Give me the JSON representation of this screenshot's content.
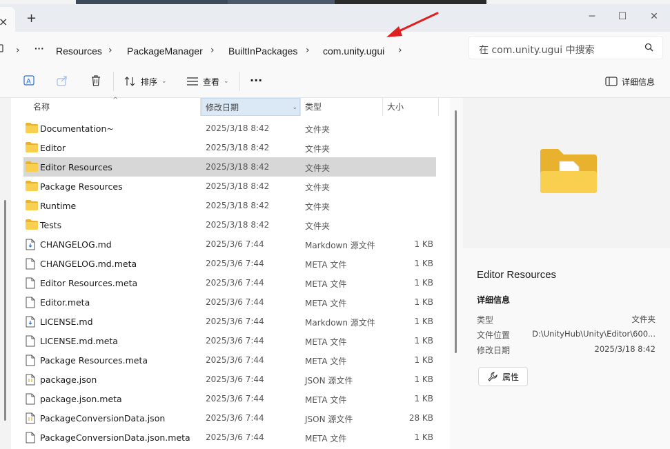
{
  "window": {
    "tab_close_icon": "×",
    "new_tab_icon": "+",
    "minimize": "─",
    "maximize": "☐",
    "close": "✕"
  },
  "breadcrumb": {
    "more": "···",
    "items": [
      "Resources",
      "PackageManager",
      "BuiltInPackages",
      "com.unity.ugui"
    ]
  },
  "search": {
    "placeholder": "在 com.unity.ugui 中搜索"
  },
  "toolbar": {
    "sort_label": "排序",
    "view_label": "查看",
    "more_label": "···",
    "details_label": "详细信息"
  },
  "columns": {
    "name": "名称",
    "date": "修改日期",
    "type": "类型",
    "size": "大小"
  },
  "files": [
    {
      "name": "Documentation~",
      "date": "2025/3/18 8:42",
      "type": "文件夹",
      "size": "",
      "icon": "folder-icon"
    },
    {
      "name": "Editor",
      "date": "2025/3/18 8:42",
      "type": "文件夹",
      "size": "",
      "icon": "folder-icon"
    },
    {
      "name": "Editor Resources",
      "date": "2025/3/18 8:42",
      "type": "文件夹",
      "size": "",
      "icon": "folder-icon",
      "selected": true
    },
    {
      "name": "Package Resources",
      "date": "2025/3/18 8:42",
      "type": "文件夹",
      "size": "",
      "icon": "folder-icon"
    },
    {
      "name": "Runtime",
      "date": "2025/3/18 8:42",
      "type": "文件夹",
      "size": "",
      "icon": "folder-icon"
    },
    {
      "name": "Tests",
      "date": "2025/3/18 8:42",
      "type": "文件夹",
      "size": "",
      "icon": "folder-icon"
    },
    {
      "name": "CHANGELOG.md",
      "date": "2025/3/6 7:44",
      "type": "Markdown 源文件",
      "size": "1 KB",
      "icon": "markdown-file-icon"
    },
    {
      "name": "CHANGELOG.md.meta",
      "date": "2025/3/6 7:44",
      "type": "META 文件",
      "size": "1 KB",
      "icon": "file-icon"
    },
    {
      "name": "Editor Resources.meta",
      "date": "2025/3/6 7:44",
      "type": "META 文件",
      "size": "1 KB",
      "icon": "file-icon"
    },
    {
      "name": "Editor.meta",
      "date": "2025/3/6 7:44",
      "type": "META 文件",
      "size": "1 KB",
      "icon": "file-icon"
    },
    {
      "name": "LICENSE.md",
      "date": "2025/3/6 7:44",
      "type": "Markdown 源文件",
      "size": "1 KB",
      "icon": "markdown-file-icon"
    },
    {
      "name": "LICENSE.md.meta",
      "date": "2025/3/6 7:44",
      "type": "META 文件",
      "size": "1 KB",
      "icon": "file-icon"
    },
    {
      "name": "Package Resources.meta",
      "date": "2025/3/6 7:44",
      "type": "META 文件",
      "size": "1 KB",
      "icon": "file-icon"
    },
    {
      "name": "package.json",
      "date": "2025/3/6 7:44",
      "type": "JSON 源文件",
      "size": "1 KB",
      "icon": "json-file-icon"
    },
    {
      "name": "package.json.meta",
      "date": "2025/3/6 7:44",
      "type": "META 文件",
      "size": "1 KB",
      "icon": "file-icon"
    },
    {
      "name": "PackageConversionData.json",
      "date": "2025/3/6 7:44",
      "type": "JSON 源文件",
      "size": "28 KB",
      "icon": "json-file-icon"
    },
    {
      "name": "PackageConversionData.json.meta",
      "date": "2025/3/6 7:44",
      "type": "META 文件",
      "size": "1 KB",
      "icon": "file-icon"
    }
  ],
  "details": {
    "title": "Editor Resources",
    "section": "详细信息",
    "type_label": "类型",
    "type_value": "文件夹",
    "location_label": "文件位置",
    "location_value": "D:\\UnityHub\\Unity\\Editor\\600...",
    "modified_label": "修改日期",
    "modified_value": "2025/3/18 8:42",
    "properties_button": "属性"
  },
  "colors": {
    "folder": "#f4c542",
    "folder_dark": "#e8b22e",
    "selected_row": "#d7d7d7",
    "sorted_header": "#dbe8f5",
    "annotation_arrow": "#e02020"
  }
}
